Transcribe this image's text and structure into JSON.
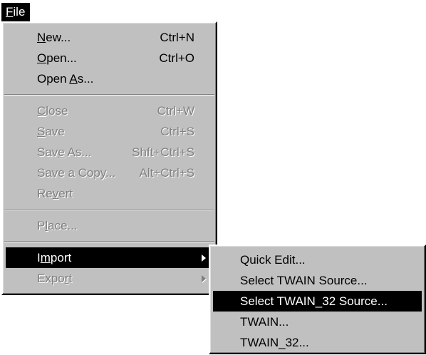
{
  "menubar": {
    "file": {
      "pre": "",
      "key": "F",
      "post": "ile"
    }
  },
  "file_menu": {
    "new": {
      "key": "N",
      "post": "ew...",
      "shortcut": "Ctrl+N"
    },
    "open": {
      "key": "O",
      "post": "pen...",
      "shortcut": "Ctrl+O"
    },
    "open_as": {
      "pre": "Open ",
      "key": "A",
      "post": "s..."
    },
    "close": {
      "key": "C",
      "post": "lose",
      "shortcut": "Ctrl+W"
    },
    "save": {
      "key": "S",
      "post": "ave",
      "shortcut": "Ctrl+S"
    },
    "save_as": {
      "pre": "Sav",
      "key": "e",
      "post": " As...",
      "shortcut": "Shft+Ctrl+S"
    },
    "save_copy": {
      "pre": "Save a Cop",
      "key": "y",
      "post": "...",
      "shortcut": "Alt+Ctrl+S"
    },
    "revert": {
      "pre": "Re",
      "key": "v",
      "post": "ert"
    },
    "place": {
      "pre": "P",
      "key": "l",
      "post": "ace..."
    },
    "import": {
      "pre": "I",
      "key": "m",
      "post": "port"
    },
    "export": {
      "pre": "Expo",
      "key": "r",
      "post": "t"
    }
  },
  "import_submenu": {
    "items": [
      "Quick Edit...",
      "Select TWAIN Source...",
      "Select TWAIN_32 Source...",
      "TWAIN...",
      "TWAIN_32..."
    ]
  },
  "colors": {
    "menu_bg": "#c0c0c0",
    "highlight_bg": "#000000",
    "highlight_fg": "#ffffff",
    "disabled_fg": "#808080"
  }
}
